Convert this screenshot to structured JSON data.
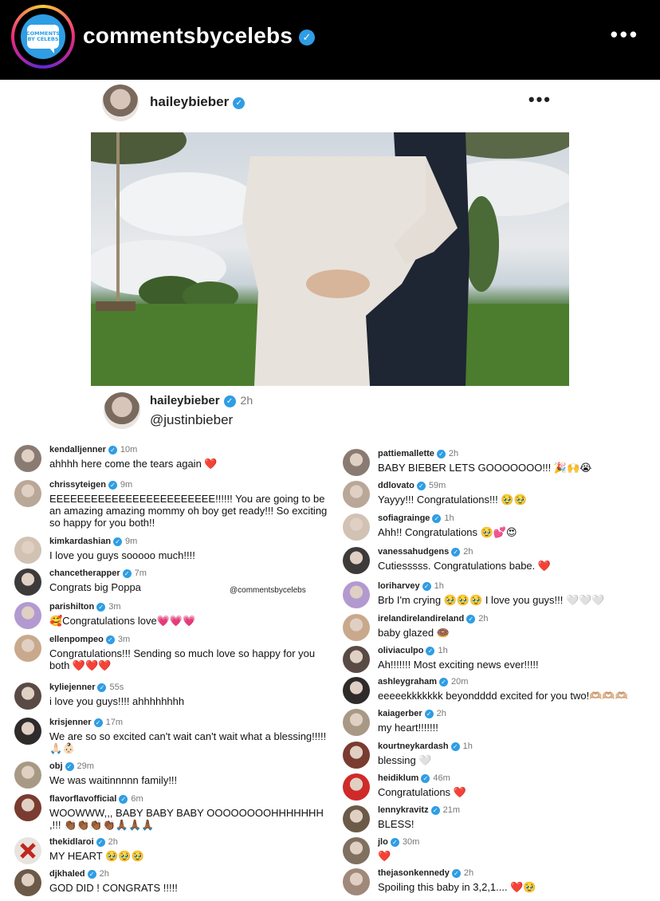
{
  "header": {
    "account_name": "commentsbycelebs",
    "logo_text_line1": "COMMENTS",
    "logo_text_line2": "BY CELEBS",
    "more_label": "•••"
  },
  "post": {
    "username": "haileybieber",
    "more_label": "•••",
    "caption_user": "haileybieber",
    "caption_time": "2h",
    "caption_text": "@justinbieber"
  },
  "watermark": "@commentsbycelebs",
  "comments_left": [
    {
      "user": "kendalljenner",
      "time": "10m",
      "text": "ahhhh here come the tears again ❤️"
    },
    {
      "user": "chrissyteigen",
      "time": "9m",
      "text": "EEEEEEEEEEEEEEEEEEEEEEEE!!!!!! You are going to be an amazing amazing mommy oh boy get ready!!! So exciting so happy for you both!!"
    },
    {
      "user": "kimkardashian",
      "time": "9m",
      "text": "I love you guys sooooo much!!!!"
    },
    {
      "user": "chancetherapper",
      "time": "7m",
      "text": "Congrats big Poppa"
    },
    {
      "user": "parishilton",
      "time": "3m",
      "text": "🥰Congratulations love💗💗💗"
    },
    {
      "user": "ellenpompeo",
      "time": "3m",
      "text": "Congratulations!!! Sending so much love so happy for you both ❤️❤️❤️"
    },
    {
      "user": "kyliejenner",
      "time": "55s",
      "text": "i love you guys!!!! ahhhhhhhh"
    },
    {
      "user": "krisjenner",
      "time": "17m",
      "text": "We are so so excited can't wait can't wait what a blessing!!!!! 🙏🏻👶🏻"
    },
    {
      "user": "obj",
      "time": "29m",
      "text": "We was waitinnnnn family!!!"
    },
    {
      "user": "flavorflavofficial",
      "time": "6m",
      "text": "WOOWWW,,, BABY BABY BABY OOOOOOOOHHHHHHH ,!!! 👏🏾👏🏾👏🏾👏🏾🙏🏾🙏🏾🙏🏾"
    },
    {
      "user": "thekidlaroi",
      "time": "2h",
      "text": "MY HEART 🥹🥹🥹"
    },
    {
      "user": "djkhaled",
      "time": "2h",
      "text": "GOD DID ! CONGRATS !!!!!"
    }
  ],
  "comments_right": [
    {
      "user": "pattiemallette",
      "time": "2h",
      "text": "BABY BIEBER LETS GOOOOOOO!!! 🎉🙌😭"
    },
    {
      "user": "ddlovato",
      "time": "59m",
      "text": "Yayyy!!! Congratulations!!! 🥹🥹"
    },
    {
      "user": "sofiagrainge",
      "time": "1h",
      "text": "Ahh!! Congratulations 🥹💕😍"
    },
    {
      "user": "vanessahudgens",
      "time": "2h",
      "text": "Cutiesssss. Congratulations babe. ❤️"
    },
    {
      "user": "loriharvey",
      "time": "1h",
      "text": "Brb I'm crying 🥹🥹🥹 I love you guys!!! 🤍🤍🤍"
    },
    {
      "user": "irelandirelandireland",
      "time": "2h",
      "text": "baby glazed 🍩"
    },
    {
      "user": "oliviaculpo",
      "time": "1h",
      "text": "Ah!!!!!!! Most exciting news ever!!!!!"
    },
    {
      "user": "ashleygraham",
      "time": "20m",
      "text": "eeeeekkkkkkk beyondddd excited for you two!🫶🏼🫶🏼🫶🏼"
    },
    {
      "user": "kaiagerber",
      "time": "2h",
      "text": "my heart!!!!!!!"
    },
    {
      "user": "kourtneykardash",
      "time": "1h",
      "text": "blessing 🤍"
    },
    {
      "user": "heidiklum",
      "time": "46m",
      "text": "Congratulations ❤️"
    },
    {
      "user": "lennykravitz",
      "time": "21m",
      "text": "BLESS!"
    },
    {
      "user": "jlo",
      "time": "30m",
      "text": "❤️"
    },
    {
      "user": "thejasonkennedy",
      "time": "2h",
      "text": "Spoiling this baby in 3,2,1.... ❤️🥹"
    }
  ]
}
